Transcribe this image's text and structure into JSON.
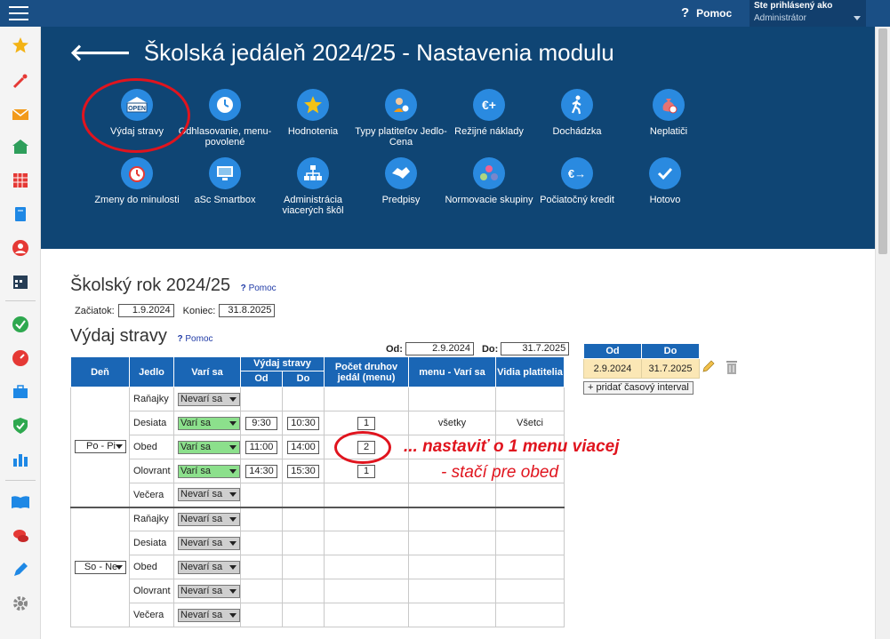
{
  "topbar": {
    "help_label": "Pomoc",
    "user_line1": "Ste prihlásený ako",
    "user_line2": "Administrátor"
  },
  "header": {
    "title": "Školská jedáleň 2024/25 - Nastavenia modulu"
  },
  "tiles": [
    {
      "label": "Výdaj stravy",
      "icon": "open-sign-icon"
    },
    {
      "label": "Odhlasovanie, menu-povolené",
      "icon": "clock-icon"
    },
    {
      "label": "Hodnotenia",
      "icon": "star-icon"
    },
    {
      "label": "Typy platiteľov Jedlo-Cena",
      "icon": "person-coin-icon"
    },
    {
      "label": "Režijné náklady",
      "icon": "euro-plus-icon"
    },
    {
      "label": "Dochádzka",
      "icon": "walking-person-icon"
    },
    {
      "label": "Neplatiči",
      "icon": "money-bag-icon"
    },
    {
      "label": "Zmeny do minulosti",
      "icon": "alarm-clock-icon"
    },
    {
      "label": "aSc Smartbox",
      "icon": "monitor-icon"
    },
    {
      "label": "Administrácia viacerých škôl",
      "icon": "org-chart-icon"
    },
    {
      "label": "Predpisy",
      "icon": "handshake-icon"
    },
    {
      "label": "Normovacie skupiny",
      "icon": "dots-group-icon"
    },
    {
      "label": "Počiatočný kredit",
      "icon": "euro-arrow-icon"
    },
    {
      "label": "Hotovo",
      "icon": "checkmark-icon"
    }
  ],
  "school_year": {
    "heading": "Školský rok 2024/25",
    "help": "Pomoc",
    "start_label": "Začiatok:",
    "start_value": "1.9.2024",
    "end_label": "Koniec:",
    "end_value": "31.8.2025"
  },
  "vydaj": {
    "heading": "Výdaj stravy",
    "help": "Pomoc",
    "od_label": "Od:",
    "od_value": "2.9.2024",
    "do_label": "Do:",
    "do_value": "31.7.2025"
  },
  "table": {
    "headers": {
      "den": "Deň",
      "jedlo": "Jedlo",
      "vari_sa": "Varí sa",
      "vydaj": "Výdaj stravy",
      "od": "Od",
      "do": "Do",
      "pocet": "Počet druhov jedál (menu)",
      "menu": "menu - Varí sa",
      "vidia": "Vidia platitelia"
    },
    "groups": [
      {
        "day": "Po - Pi",
        "rows": [
          {
            "meal": "Raňajky",
            "status": "Nevarí sa",
            "cooked": false,
            "od": "",
            "do": "",
            "count": "",
            "menu": "",
            "vidia": ""
          },
          {
            "meal": "Desiata",
            "status": "Varí sa",
            "cooked": true,
            "od": "9:30",
            "do": "10:30",
            "count": "1",
            "menu": "všetky",
            "vidia": "Všetci"
          },
          {
            "meal": "Obed",
            "status": "Varí sa",
            "cooked": true,
            "od": "11:00",
            "do": "14:00",
            "count": "2",
            "menu": "",
            "vidia": ""
          },
          {
            "meal": "Olovrant",
            "status": "Varí sa",
            "cooked": true,
            "od": "14:30",
            "do": "15:30",
            "count": "1",
            "menu": "",
            "vidia": ""
          },
          {
            "meal": "Večera",
            "status": "Nevarí sa",
            "cooked": false,
            "od": "",
            "do": "",
            "count": "",
            "menu": "",
            "vidia": ""
          }
        ]
      },
      {
        "day": "So - Ne",
        "rows": [
          {
            "meal": "Raňajky",
            "status": "Nevarí sa",
            "cooked": false,
            "od": "",
            "do": "",
            "count": "",
            "menu": "",
            "vidia": ""
          },
          {
            "meal": "Desiata",
            "status": "Nevarí sa",
            "cooked": false,
            "od": "",
            "do": "",
            "count": "",
            "menu": "",
            "vidia": ""
          },
          {
            "meal": "Obed",
            "status": "Nevarí sa",
            "cooked": false,
            "od": "",
            "do": "",
            "count": "",
            "menu": "",
            "vidia": ""
          },
          {
            "meal": "Olovrant",
            "status": "Nevarí sa",
            "cooked": false,
            "od": "",
            "do": "",
            "count": "",
            "menu": "",
            "vidia": ""
          },
          {
            "meal": "Večera",
            "status": "Nevarí sa",
            "cooked": false,
            "od": "",
            "do": "",
            "count": "",
            "menu": "",
            "vidia": ""
          }
        ]
      }
    ]
  },
  "interval_table": {
    "header_od": "Od",
    "header_do": "Do",
    "od": "2.9.2024",
    "do": "31.7.2025",
    "add_button": "+ pridať časový interval"
  },
  "annotation": {
    "line1": "... nastaviť o 1 menu viacej",
    "line2": "- stačí pre obed"
  },
  "colors": {
    "header_bg": "#0f4574",
    "table_header": "#1a66b5",
    "annotation_red": "#e0141e",
    "cooked_green": "#8ce08c",
    "interval_row": "#fbe7b5"
  }
}
